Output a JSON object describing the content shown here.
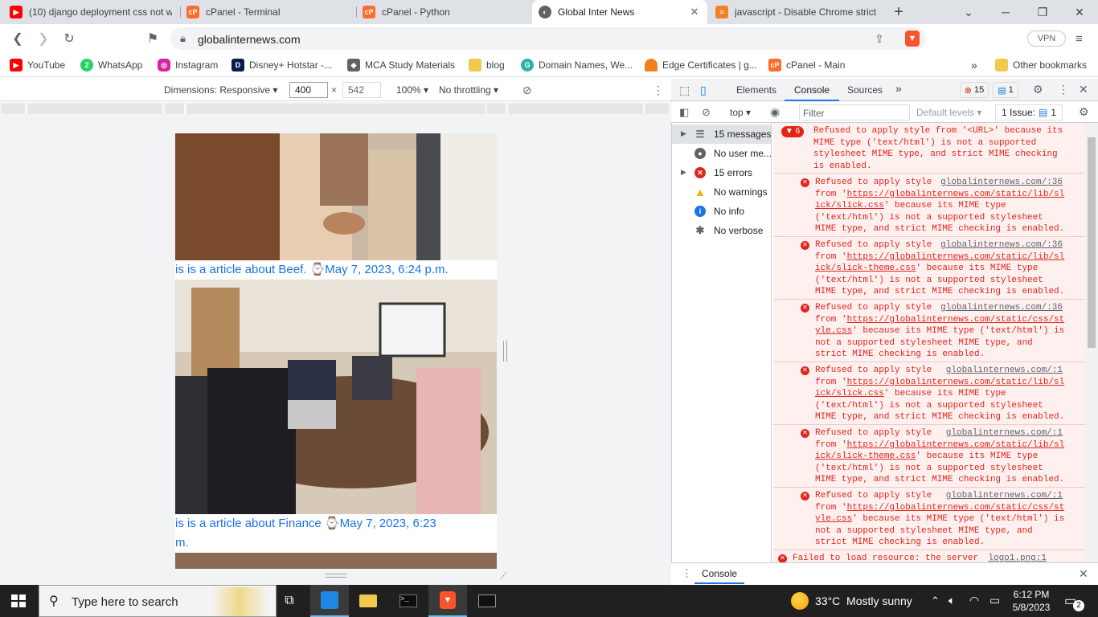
{
  "tabs": [
    {
      "title": "(10) django deployment css not w",
      "icon": "youtube-icon",
      "color": "#ff0000"
    },
    {
      "title": "cPanel - Terminal",
      "icon": "cpanel-icon",
      "color": "#ff6c2c"
    },
    {
      "title": "cPanel - Python",
      "icon": "cpanel-icon",
      "color": "#ff6c2c"
    },
    {
      "title": "Global Inter News",
      "icon": "globe-icon",
      "color": "#5f6368",
      "active": true
    },
    {
      "title": "javascript - Disable Chrome strict",
      "icon": "stackoverflow-icon",
      "color": "#f48024"
    }
  ],
  "toolbar": {
    "url": "globalinternews.com",
    "vpn": "VPN"
  },
  "bookmarks": [
    {
      "label": "YouTube",
      "icon": "youtube-icon",
      "color": "#ff0000"
    },
    {
      "label": "WhatsApp",
      "icon": "whatsapp-icon",
      "color": "#25d366",
      "badge": "2"
    },
    {
      "label": "Instagram",
      "icon": "instagram-icon",
      "color": "#d6249f"
    },
    {
      "label": "Disney+ Hotstar -...",
      "icon": "hotstar-icon",
      "color": "#0c1b4d"
    },
    {
      "label": "MCA Study Materials",
      "icon": "study-icon",
      "color": "#5f6368"
    },
    {
      "label": "blog",
      "icon": "folder-icon",
      "color": "#f2c94c"
    },
    {
      "label": "Domain Names, We...",
      "icon": "domain-icon",
      "color": "#2bb3a3"
    },
    {
      "label": "Edge Certificates | g...",
      "icon": "cloudflare-icon",
      "color": "#f38020"
    },
    {
      "label": "cPanel - Main",
      "icon": "cpanel-icon",
      "color": "#ff6c2c"
    }
  ],
  "bookmarks_more": "»",
  "other_bookmarks": "Other bookmarks",
  "devbar": {
    "dimensions": "Dimensions: Responsive",
    "width": "400",
    "times": "×",
    "height": "542",
    "zoom": "100%",
    "throttling": "No throttling"
  },
  "page": {
    "caption1": "is is a article about Beef. ⌚May 7, 2023, 6:24 p.m.",
    "caption2a": "is is a article about Finance ⌚May 7, 2023, 6:23",
    "caption2b": "m."
  },
  "devtools": {
    "tabs": [
      "Elements",
      "Console",
      "Sources"
    ],
    "active_tab": "Console",
    "error_count": "15",
    "issue_count": "1",
    "context": "top",
    "filter_placeholder": "Filter",
    "levels": "Default levels",
    "issues": "1 Issue:",
    "issues_count": "1"
  },
  "sidebar": [
    {
      "label": "15 messages",
      "icon": "list-icon"
    },
    {
      "label": "No user me...",
      "icon": "user-icon"
    },
    {
      "label": "15 errors",
      "icon": "error-icon"
    },
    {
      "label": "No warnings",
      "icon": "warning-icon"
    },
    {
      "label": "No info",
      "icon": "info-icon"
    },
    {
      "label": "No verbose",
      "icon": "verbose-icon"
    }
  ],
  "console_group": {
    "count": "6",
    "lines": [
      "Refused to apply style from '<URL>' because its",
      "MIME type ('text/html') is not a supported",
      "stylesheet MIME type, and strict MIME checking",
      "is enabled."
    ]
  },
  "console_messages": [
    {
      "src": "globalinternews.com/:36",
      "l1": "Refused to apply style",
      "l2": "from '",
      "link": "https://globalinternews.com/static/lib/sl",
      "link2": "ick/slick.css",
      "rest": [
        "' because its MIME type",
        "('text/html') is not a supported stylesheet",
        "MIME type, and strict MIME checking is enabled."
      ]
    },
    {
      "src": "globalinternews.com/:36",
      "l1": "Refused to apply style",
      "l2": "from '",
      "link": "https://globalinternews.com/static/lib/sl",
      "link2": "ick/slick-theme.css",
      "rest": [
        "' because its MIME type",
        "('text/html') is not a supported stylesheet",
        "MIME type, and strict MIME checking is enabled."
      ]
    },
    {
      "src": "globalinternews.com/:36",
      "l1": "Refused to apply style",
      "l2": "from '",
      "link": "https://globalinternews.com/static/css/st",
      "link2": "yle.css",
      "rest": [
        "' because its MIME type ('text/html') is",
        "not a supported stylesheet MIME type, and",
        "strict MIME checking is enabled."
      ]
    },
    {
      "src": "globalinternews.com/:1",
      "l1": "Refused to apply style",
      "l2": "from '",
      "link": "https://globalinternews.com/static/lib/sl",
      "link2": "ick/slick.css",
      "rest": [
        "' because its MIME type",
        "('text/html') is not a supported stylesheet",
        "MIME type, and strict MIME checking is enabled."
      ]
    },
    {
      "src": "globalinternews.com/:1",
      "l1": "Refused to apply style",
      "l2": "from '",
      "link": "https://globalinternews.com/static/lib/sl",
      "link2": "ick/slick-theme.css",
      "rest": [
        "' because its MIME type",
        "('text/html') is not a supported stylesheet",
        "MIME type, and strict MIME checking is enabled."
      ]
    },
    {
      "src": "globalinternews.com/:1",
      "l1": "Refused to apply style",
      "l2": "from '",
      "link": "https://globalinternews.com/static/css/st",
      "link2": "yle.css",
      "rest": [
        "' because its MIME type ('text/html') is",
        "not a supported stylesheet MIME type, and",
        "strict MIME checking is enabled."
      ]
    }
  ],
  "console_last": {
    "text": "Failed to load resource: the server",
    "src": "logo1.png:1"
  },
  "drawer": {
    "tab": "Console"
  },
  "taskbar": {
    "search": "Type here to search",
    "weather": "33°C  Mostly sunny",
    "time": "6:12 PM",
    "date": "5/8/2023",
    "notifications": "2"
  }
}
